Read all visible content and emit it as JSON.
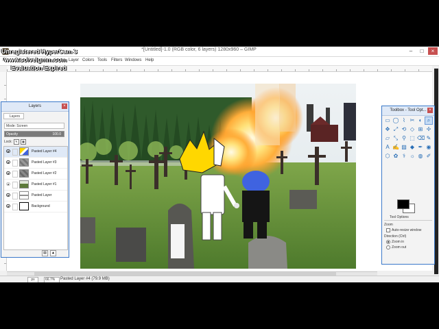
{
  "window": {
    "title": "*[Untitled]-1.0 (RGB color, 6 layers) 1280x960 – GIMP",
    "controls": [
      "–",
      "□",
      "×"
    ]
  },
  "watermark": {
    "line1": "Unregistered HyperCam 3",
    "line2": "www.solveigmm.com",
    "line3": "Evaluation Expired"
  },
  "menu": [
    "File",
    "Edit",
    "Select",
    "View",
    "Image",
    "Layer",
    "Colors",
    "Tools",
    "Filters",
    "Windows",
    "Help"
  ],
  "layers_panel": {
    "title": "Layers",
    "tab_label": "Layers",
    "mode": "Mode: Screen",
    "opacity_label": "Opacity",
    "opacity_value": "100.0",
    "lock_label": "Lock:",
    "layers": [
      {
        "name": "Pasted Layer #4"
      },
      {
        "name": "Pasted Layer #3"
      },
      {
        "name": "Pasted Layer #2"
      },
      {
        "name": "Pasted Layer #1"
      },
      {
        "name": "Pasted Layer"
      },
      {
        "name": "Background"
      }
    ]
  },
  "toolbox": {
    "title": "Toolbox - Tool Opt...",
    "tool_options_tab": "Tool Options",
    "zoom_heading": "Zoom",
    "auto_resize": "Auto-resize window",
    "direction_heading": "Direction (Ctrl)",
    "zoom_in": "Zoom in",
    "zoom_out": "Zoom out",
    "tools": [
      "▭",
      "◯",
      "⌇",
      "✂",
      "◐",
      "⌕",
      "✥",
      "⤢",
      "⟲",
      "◇",
      "⊞",
      "✢",
      "▱",
      "⤡",
      "⚲",
      "⬚",
      "⌫",
      "✎",
      "A",
      "✍",
      "▨",
      "◆",
      "✒",
      "◉",
      "⬡",
      "✿",
      "⚕",
      "☼",
      "◍",
      "✐"
    ]
  },
  "statusbar": {
    "unit": "px",
    "zoom": "66.7%",
    "text": "Pasted Layer #4 (79.9 MB)"
  },
  "colors": {
    "fg": "#000000",
    "bg": "#ffffff",
    "accent": "#3a78c9"
  }
}
